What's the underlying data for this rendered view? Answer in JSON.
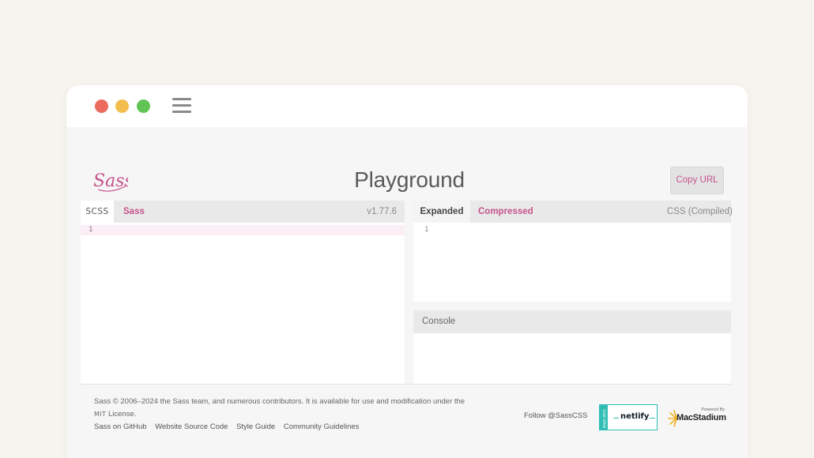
{
  "window": {
    "controls": [
      "close",
      "minimize",
      "maximize"
    ],
    "menu_icon": "hamburger-menu-icon"
  },
  "header": {
    "logo_text": "Sass",
    "title": "Playground",
    "copy_url_label": "Copy URL"
  },
  "input_editor": {
    "tabs": [
      {
        "label": "SCSS",
        "active": true
      },
      {
        "label": "Sass",
        "active": false
      }
    ],
    "version": "v1.77.6",
    "lines": [
      {
        "number": "1",
        "text": ""
      }
    ]
  },
  "output_editor": {
    "tabs": [
      {
        "label": "Expanded",
        "active": true
      },
      {
        "label": "Compressed",
        "active": false
      }
    ],
    "label": "CSS (Compiled)",
    "lines": [
      {
        "number": "1",
        "text": ""
      }
    ]
  },
  "console": {
    "title": "Console"
  },
  "footer": {
    "copyright": "Sass © 2006–2024 the Sass team, and numerous contributors. It is available for use and modification under the",
    "license_abbr": "MIT",
    "license_word": "License.",
    "links": [
      "Sass on GitHub",
      "Website Source Code",
      "Style Guide",
      "Community Guidelines"
    ],
    "follow": "Follow @SassCSS",
    "netlify_side": "MADE WITH",
    "netlify_label": "netlify",
    "macstadium_powered": "Powered By",
    "macstadium_name": "MacStadium"
  },
  "colors": {
    "accent": "#c6538c",
    "page_background": "#f7f4ef",
    "netlify": "#2fbdb4",
    "macstadium": "#f2b01e"
  }
}
